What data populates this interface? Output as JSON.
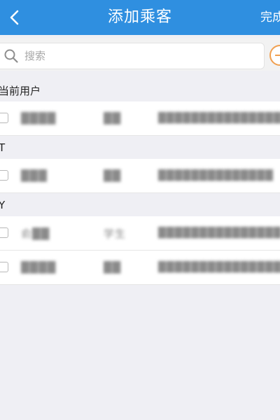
{
  "navbar": {
    "back_icon": "chevron-left-icon",
    "title": "添加乘客",
    "done_label": "完成"
  },
  "search": {
    "placeholder": "搜索",
    "add_icon": "add-circle-icon"
  },
  "groups": [
    {
      "header": "当前用户",
      "rows": [
        {
          "name": "████",
          "type": "██",
          "id": "████████████████"
        }
      ]
    },
    {
      "header": "T",
      "rows": [
        {
          "name": "███",
          "type": "██",
          "id": "██████████████"
        }
      ]
    },
    {
      "header": "Y",
      "rows": [
        {
          "name": "俞██",
          "type": "学生",
          "id": "███████████████"
        },
        {
          "name": "████",
          "type": "██",
          "id": "████████████████"
        }
      ]
    }
  ],
  "colors": {
    "navbar": "#2f8fe0",
    "background": "#efeff4",
    "accent_add": "#f0a050"
  }
}
